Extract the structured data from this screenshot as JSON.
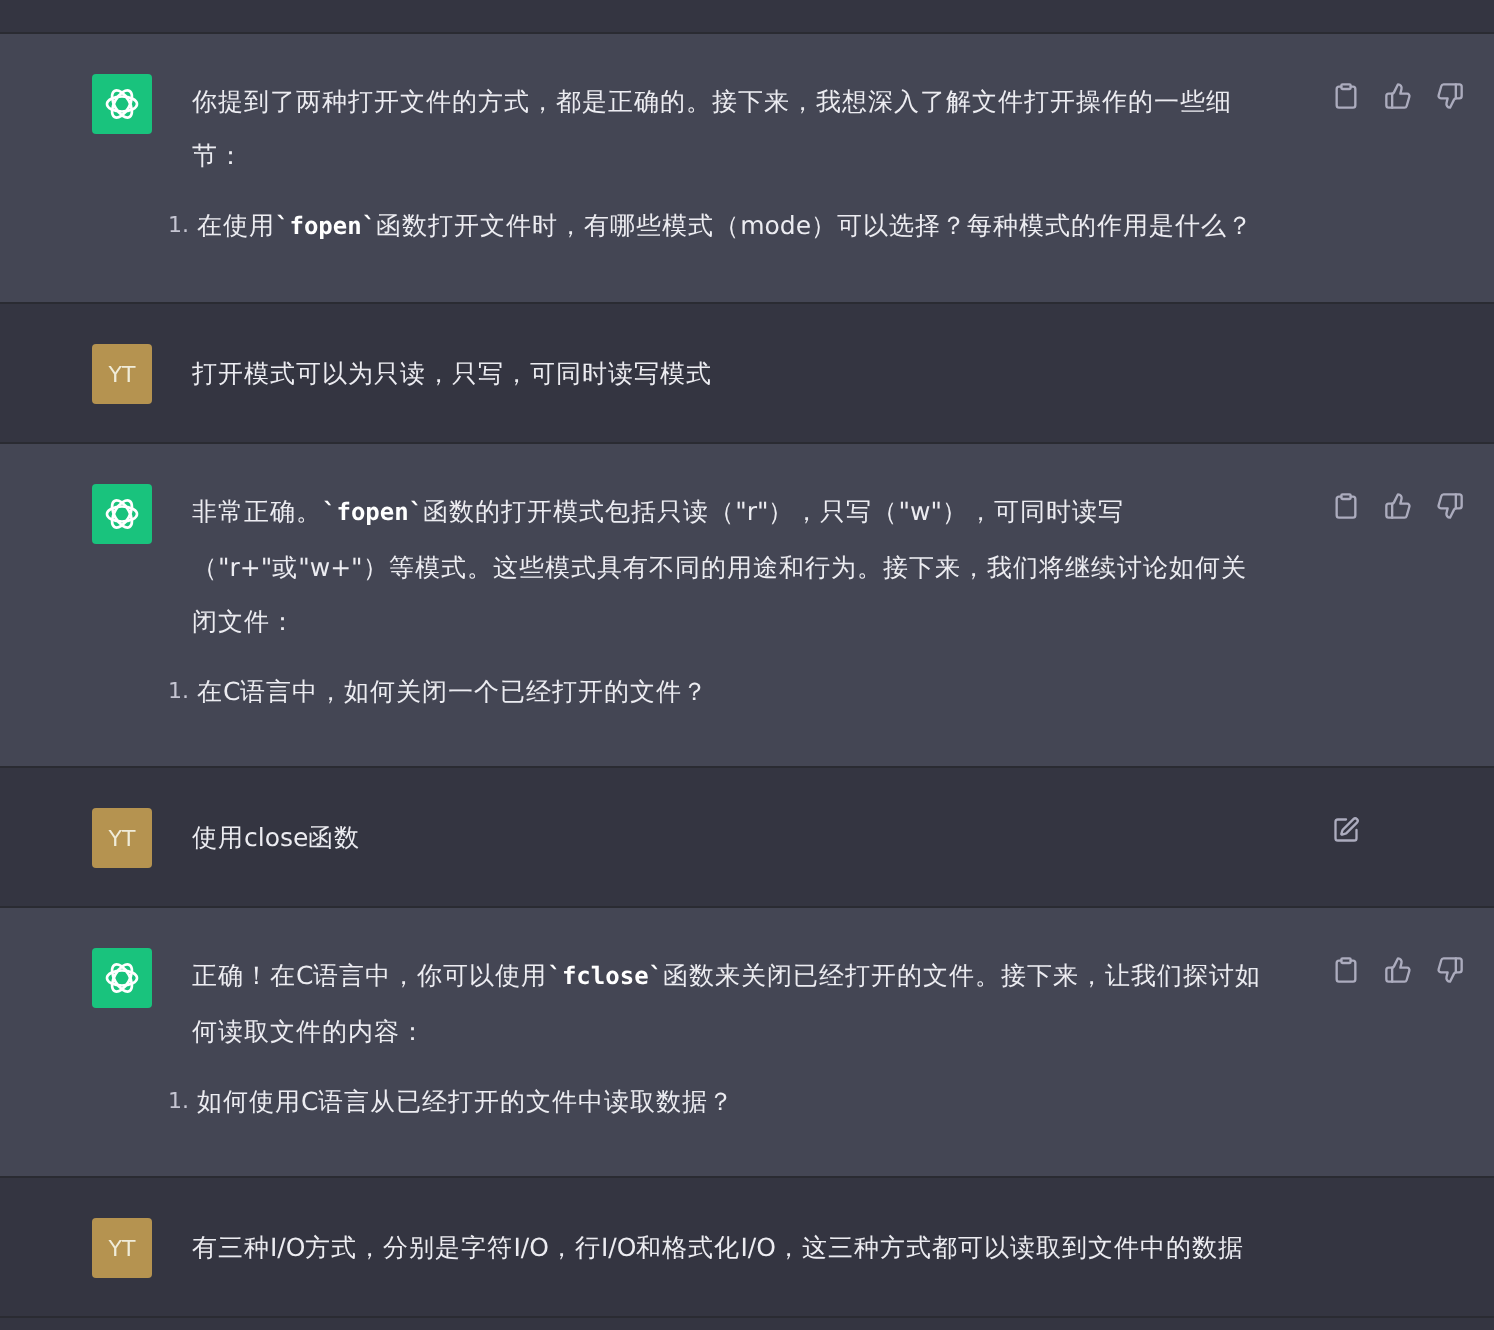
{
  "messages": [
    {
      "kind": "assistant",
      "paragraph": [
        {
          "kind": "text",
          "text": "你提到了两种打开文件的方式，都是正确的。接下来，我想深入了解文件打开操作的一些细节："
        }
      ],
      "list": [
        {
          "marker": "1.",
          "parts": [
            {
              "kind": "text",
              "text": "在使用"
            },
            {
              "kind": "code",
              "text": "`fopen`"
            },
            {
              "kind": "text",
              "text": "函数打开文件时，有哪些模式（mode）可以选择？每种模式的作用是什么？"
            }
          ]
        }
      ]
    },
    {
      "kind": "user",
      "avatar": "YT",
      "text": "打开模式可以为只读，只写，可同时读写模式",
      "editable": false
    },
    {
      "kind": "assistant",
      "paragraph": [
        {
          "kind": "text",
          "text": "非常正确。"
        },
        {
          "kind": "code",
          "text": "`fopen`"
        },
        {
          "kind": "text",
          "text": "函数的打开模式包括只读（\"r\"），只写（\"w\"），可同时读写（\"r+\"或\"w+\"）等模式。这些模式具有不同的用途和行为。接下来，我们将继续讨论如何关闭文件："
        }
      ],
      "list": [
        {
          "marker": "1.",
          "parts": [
            {
              "kind": "text",
              "text": "在C语言中，如何关闭一个已经打开的文件？"
            }
          ]
        }
      ]
    },
    {
      "kind": "user",
      "avatar": "YT",
      "text": "使用close函数",
      "editable": true
    },
    {
      "kind": "assistant",
      "paragraph": [
        {
          "kind": "text",
          "text": "正确！在C语言中，你可以使用"
        },
        {
          "kind": "code",
          "text": "`fclose`"
        },
        {
          "kind": "text",
          "text": "函数来关闭已经打开的文件。接下来，让我们探讨如何读取文件的内容："
        }
      ],
      "list": [
        {
          "marker": "1.",
          "parts": [
            {
              "kind": "text",
              "text": "如何使用C语言从已经打开的文件中读取数据？"
            }
          ]
        }
      ]
    },
    {
      "kind": "user",
      "avatar": "YT",
      "text": "有三种I/O方式，分别是字符I/O，行I/O和格式化I/O，这三种方式都可以读取到文件中的数据",
      "editable": false
    }
  ]
}
